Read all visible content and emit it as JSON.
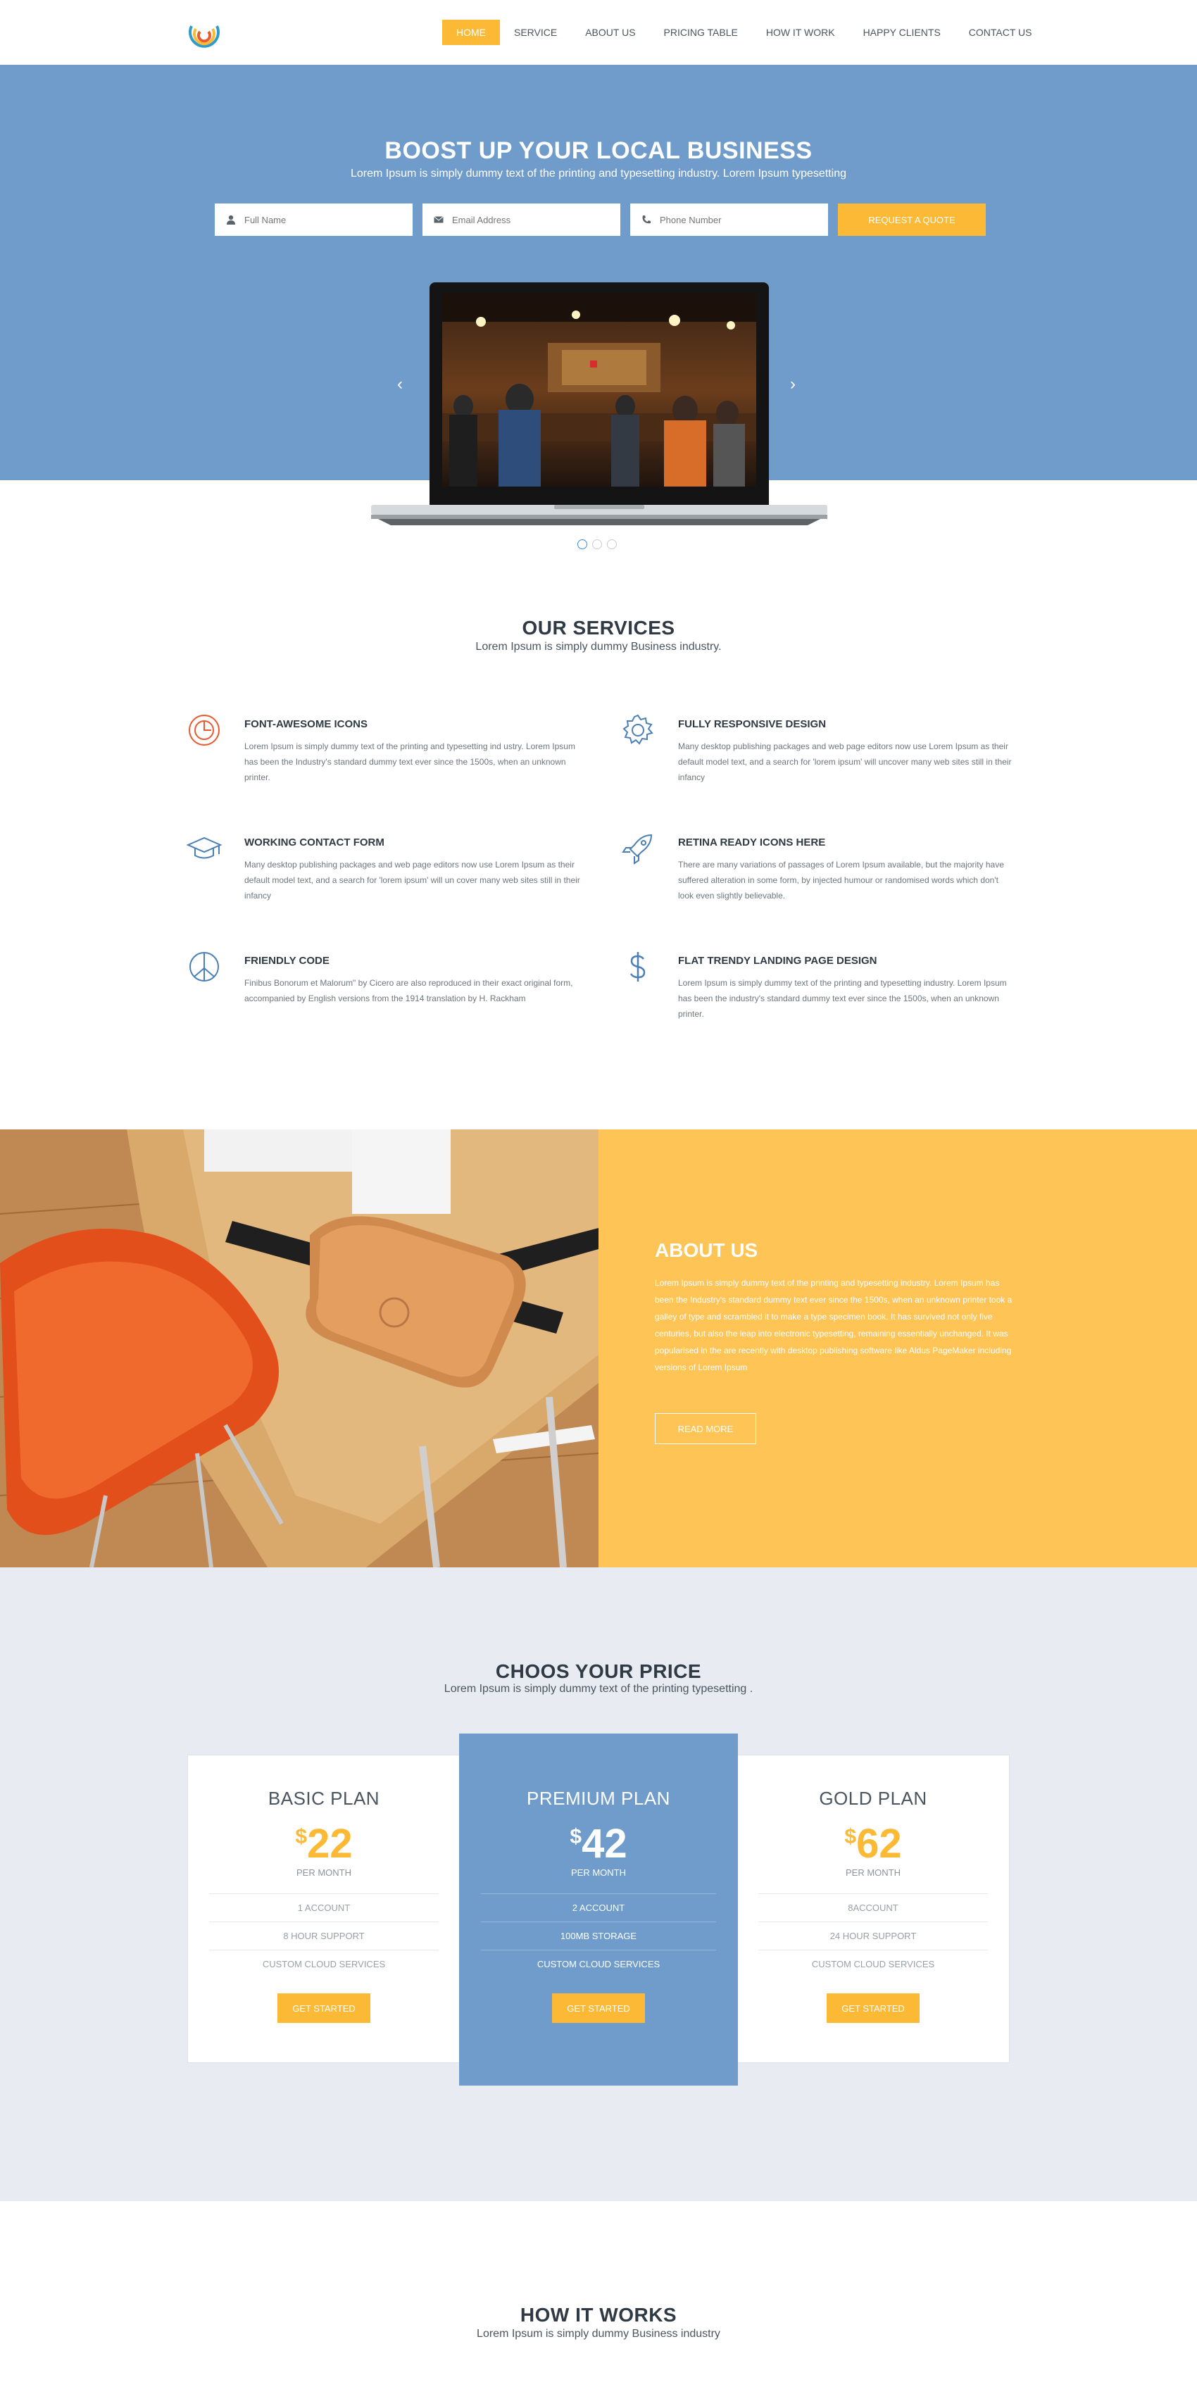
{
  "nav": {
    "items": [
      "HOME",
      "SERVICE",
      "ABOUT US",
      "PRICING TABLE",
      "HOW IT WORK",
      "HAPPY CLIENTS",
      "CONTACT US"
    ],
    "active": "HOME"
  },
  "hero": {
    "title": "BOOST UP YOUR LOCAL BUSINESS",
    "subtitle": "Lorem Ipsum is simply dummy text of the printing and typesetting industry. Lorem Ipsum typesetting",
    "form": {
      "name_placeholder": "Full Name",
      "email_placeholder": "Email Address",
      "phone_placeholder": "Phone Number",
      "button": "REQUEST A QUOTE"
    },
    "slider": {
      "prev_icon": "chevron-left-icon",
      "next_icon": "chevron-right-icon",
      "dot_count": 3,
      "active_dot": 1
    }
  },
  "services": {
    "title": "OUR SERVICES",
    "subtitle": "Lorem Ipsum is simply dummy Business industry.",
    "items": [
      {
        "icon": "target-icon",
        "title": "FONT-AWESOME ICONS",
        "text": "Lorem Ipsum is simply dummy text of the printing and typesetting ind ustry. Lorem Ipsum has been the Industry's standard dummy text ever since the 1500s, when an unknown printer."
      },
      {
        "icon": "gear-icon",
        "title": "FULLY RESPONSIVE DESIGN",
        "text": "Many desktop publishing packages and web page editors now use Lorem Ipsum as their default model text, and a search for 'lorem ipsum' will uncover many web sites still in their infancy"
      },
      {
        "icon": "graduation-cap-icon",
        "title": "WORKING CONTACT FORM",
        "text": "Many desktop publishing packages and web page editors now use Lorem Ipsum as their default model text, and a search for 'lorem ipsum' will un cover many web sites still in their infancy"
      },
      {
        "icon": "rocket-icon",
        "title": "RETINA READY ICONS HERE",
        "text": "There are many variations of passages of Lorem Ipsum available, but the majority have suffered alteration in some form, by injected humour or randomised words which don't look even slightly believable."
      },
      {
        "icon": "peace-icon",
        "title": "FRIENDLY CODE",
        "text": "Finibus Bonorum et Malorum\" by Cicero are also reproduced in their exact original form, accompanied by English versions from the 1914 translation by H. Rackham"
      },
      {
        "icon": "dollar-icon",
        "title": "FLAT TRENDY LANDING PAGE DESIGN",
        "text": "Lorem Ipsum is simply dummy text of the printing and typesetting industry. Lorem Ipsum has been the industry's standard dummy text ever since the 1500s, when an unknown printer."
      }
    ]
  },
  "about": {
    "title": "ABOUT US",
    "text": "Lorem Ipsum is simply dummy text of the printing and typesetting industry. Lorem Ipsum has been the Industry's standard dummy text ever since the 1500s, when an unknown printer took a galley of type and scrambled it to make a type specimen book. It has survived not only five centuries, but also the leap into electronic typesetting, remaining essentially unchanged. It was popularised in the are recently with desktop publishing software like Aldus PageMaker including versions of Lorem Ipsum",
    "button": "READ MORE"
  },
  "pricing": {
    "title": "CHOOS YOUR PRICE",
    "subtitle": "Lorem Ipsum is simply dummy text of the printing typesetting .",
    "plans": [
      {
        "name": "BASIC PLAN",
        "currency": "$",
        "price": "22",
        "period": "PER MONTH",
        "features": [
          "1 ACCOUNT",
          "8 HOUR SUPPORT",
          "CUSTOM CLOUD SERVICES"
        ],
        "button": "GET STARTED"
      },
      {
        "name": "PREMIUM PLAN",
        "currency": "$",
        "price": "42",
        "period": "PER MONTH",
        "features": [
          "2 ACCOUNT",
          "100MB STORAGE",
          "CUSTOM CLOUD SERVICES"
        ],
        "button": "GET STARTED"
      },
      {
        "name": "GOLD PLAN",
        "currency": "$",
        "price": "62",
        "period": "PER MONTH",
        "features": [
          "8ACCOUNT",
          "24 HOUR SUPPORT",
          "CUSTOM CLOUD SERVICES"
        ],
        "button": "GET STARTED"
      }
    ]
  },
  "how": {
    "title": "HOW IT WORKS",
    "subtitle": "Lorem Ipsum is simply dummy Business industry"
  },
  "colors": {
    "accent": "#fbb935",
    "hero_blue": "#6f9ccb",
    "about_yellow": "#fec456",
    "pricing_bg": "#e8ecf2",
    "text_dark": "#2f3a44"
  }
}
